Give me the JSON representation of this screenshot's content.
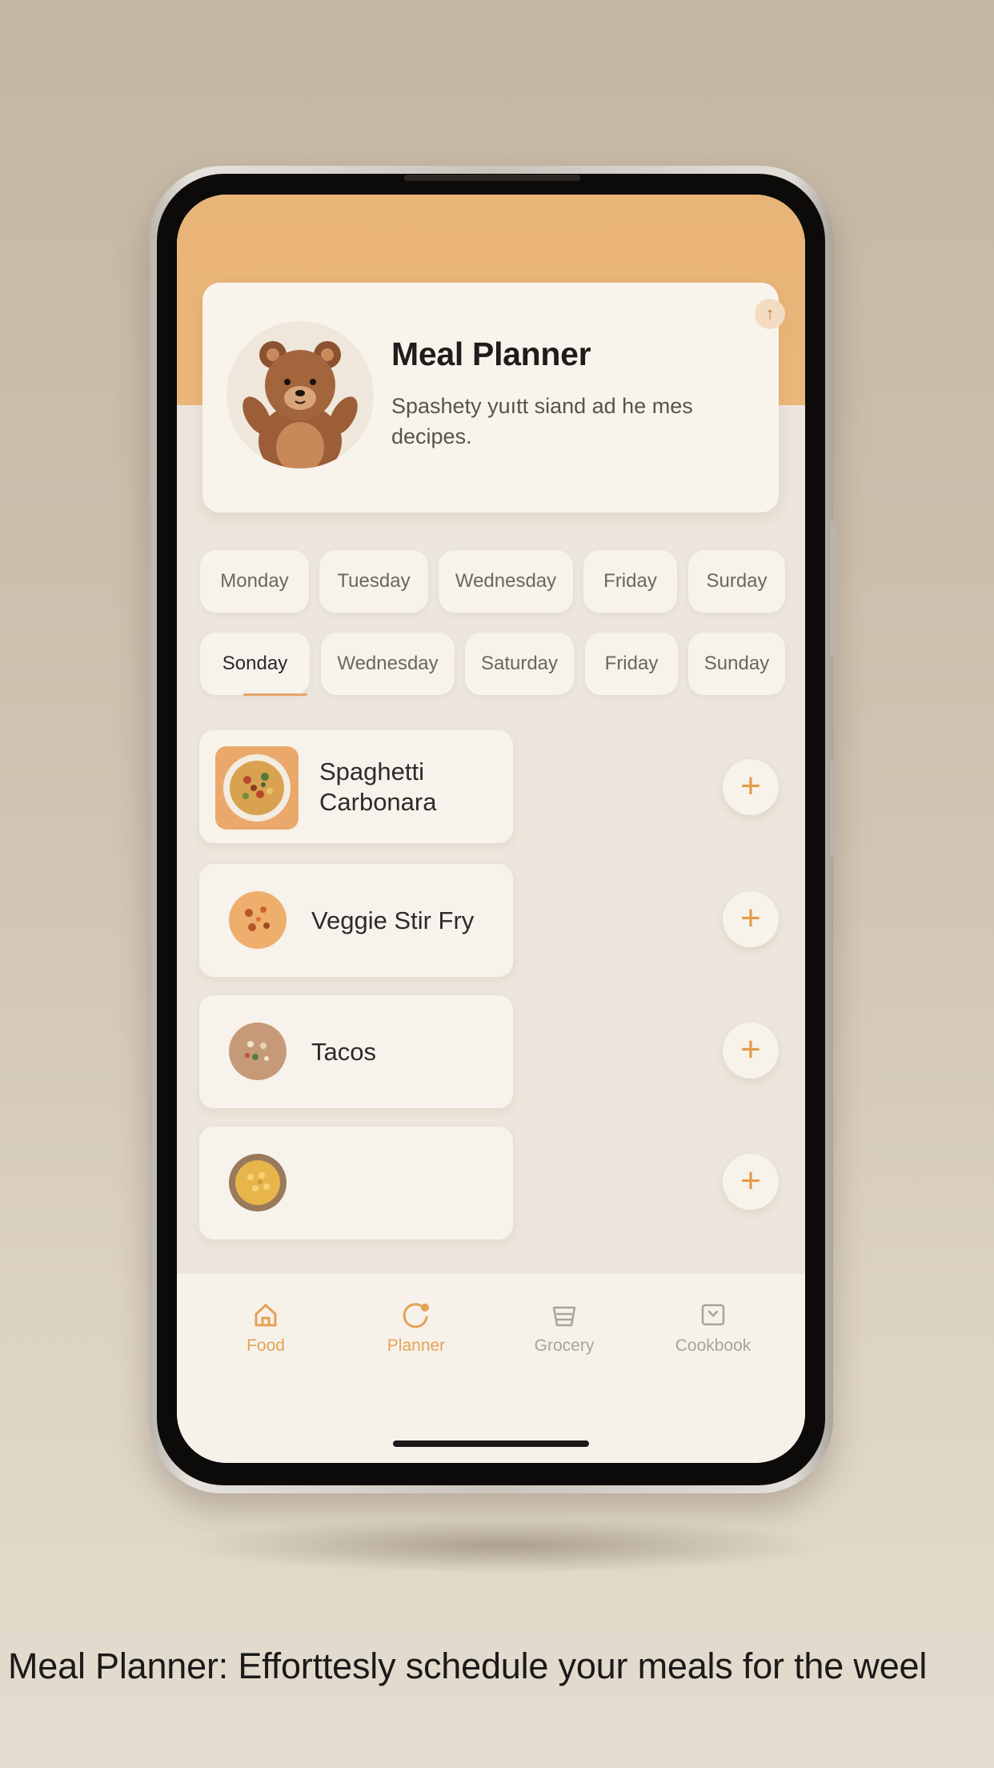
{
  "card": {
    "title": "Meal Planner",
    "subtitle": "Spashety yuıtt siand ad he mes decipes.",
    "badge": "↑"
  },
  "days_row1": [
    "Monday",
    "Tuesday",
    "Wednesday",
    "Friday",
    "Surday"
  ],
  "days_row2": [
    "Sonday",
    "Wednesday",
    "Saturday",
    "Friday",
    "Sunday"
  ],
  "selected_day": "Sonday",
  "meals": [
    {
      "name_line1": "Spaghetti",
      "name_line2": "Carbonara"
    },
    {
      "name": "Veggie Stir Fry"
    },
    {
      "name": "Tacos"
    },
    {
      "name": ""
    }
  ],
  "add_label": "+",
  "nav": [
    {
      "label": "Food",
      "icon": "home-icon",
      "active": true
    },
    {
      "label": "Planner",
      "icon": "planner-icon",
      "active": true
    },
    {
      "label": "Grocery",
      "icon": "grocery-basket-icon",
      "active": false
    },
    {
      "label": "Cookbook",
      "icon": "cookbook-icon",
      "active": false
    }
  ],
  "caption": "Meal Planner: Efforttesly schedule your meals for the weel",
  "colors": {
    "accent": "#e39a4a",
    "header": "#ebb67a",
    "nav_active": "#e6a157",
    "nav_inactive": "#a8a39b"
  }
}
